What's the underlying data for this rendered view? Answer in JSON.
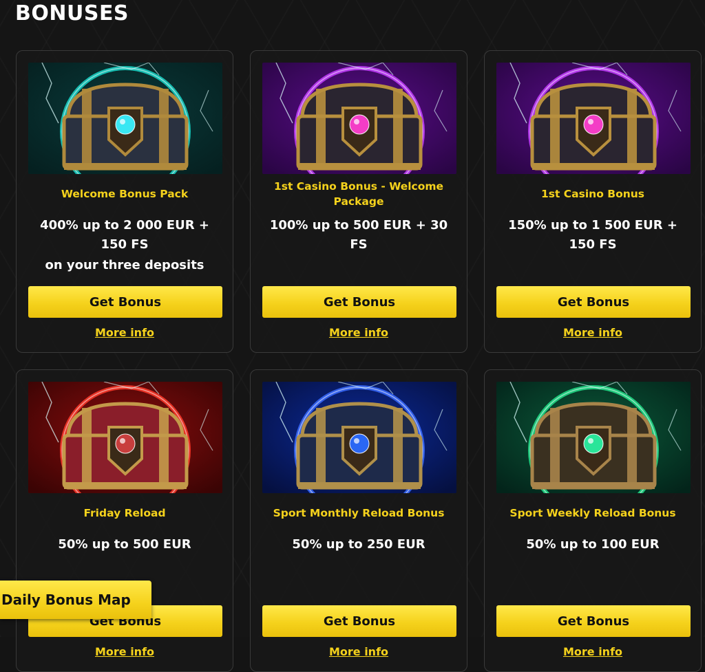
{
  "page": {
    "title": "BONUSES"
  },
  "floating": {
    "daily_bonus_map_label": "Daily Bonus Map"
  },
  "cards": [
    {
      "title": "Welcome Bonus Pack",
      "offer_line1": "400% up to 2 000 EUR + 150 FS",
      "offer_line2": "on your three deposits",
      "button_label": "Get Bonus",
      "link_label": "More info",
      "theme": "teal",
      "theme_color": "#18c2b4"
    },
    {
      "title": "1st Casino Bonus - Welcome Package",
      "offer_line1": "100% up to 500 EUR + 30 FS",
      "offer_line2": "",
      "button_label": "Get Bonus",
      "link_label": "More info",
      "theme": "purple",
      "theme_color": "#b326e0"
    },
    {
      "title": "1st Casino Bonus",
      "offer_line1": "150% up to 1 500 EUR + 150 FS",
      "offer_line2": "",
      "button_label": "Get Bonus",
      "link_label": "More info",
      "theme": "purple",
      "theme_color": "#b326e0"
    },
    {
      "title": "Friday Reload",
      "offer_line1": "50% up to 500 EUR",
      "offer_line2": "",
      "button_label": "Get Bonus",
      "link_label": "More info",
      "theme": "red",
      "theme_color": "#e3261c"
    },
    {
      "title": "Sport Monthly Reload Bonus",
      "offer_line1": "50% up to 250 EUR",
      "offer_line2": "",
      "button_label": "Get Bonus",
      "link_label": "More info",
      "theme": "blue",
      "theme_color": "#2a4fe8"
    },
    {
      "title": "Sport Weekly Reload Bonus",
      "offer_line1": "50% up to 100 EUR",
      "offer_line2": "",
      "button_label": "Get Bonus",
      "link_label": "More info",
      "theme": "green",
      "theme_color": "#16c27a"
    }
  ],
  "accent_color": "#f5d21c",
  "background_color": "#151515"
}
